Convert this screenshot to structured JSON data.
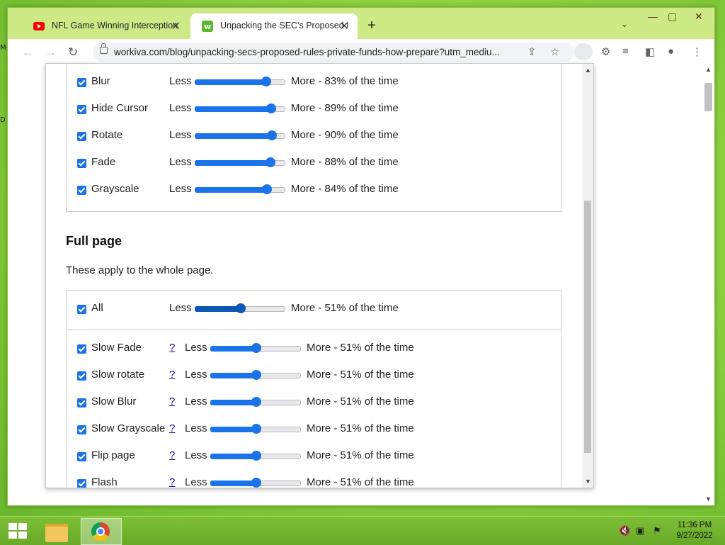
{
  "browser": {
    "tabs": [
      {
        "title": "NFL Game Winning Interception",
        "favicon": "youtube-icon",
        "active": false
      },
      {
        "title": "Unpacking the SEC's Proposed R",
        "favicon": "workiva-icon",
        "active": true
      }
    ],
    "url": "workiva.com/blog/unpacking-secs-proposed-rules-private-funds-how-prepare?utm_mediu..."
  },
  "popup": {
    "top_items": [
      {
        "label": "Blur",
        "less": "Less",
        "value": 83,
        "more": "More - 83% of the time"
      },
      {
        "label": "Hide Cursor",
        "less": "Less",
        "value": 89,
        "more": "More - 89% of the time"
      },
      {
        "label": "Rotate",
        "less": "Less",
        "value": 90,
        "more": "More - 90% of the time"
      },
      {
        "label": "Fade",
        "less": "Less",
        "value": 88,
        "more": "More - 88% of the time"
      },
      {
        "label": "Grayscale",
        "less": "Less",
        "value": 84,
        "more": "More - 84% of the time"
      }
    ],
    "full_page": {
      "heading": "Full page",
      "description": "These apply to the whole page.",
      "all": {
        "label": "All",
        "less": "Less",
        "value": 51,
        "more": "More - 51% of the time"
      },
      "items": [
        {
          "label": "Slow Fade",
          "help": "?",
          "less": "Less",
          "value": 51,
          "more": "More - 51% of the time"
        },
        {
          "label": "Slow rotate",
          "help": "?",
          "less": "Less",
          "value": 51,
          "more": "More - 51% of the time"
        },
        {
          "label": "Slow Blur",
          "help": "?",
          "less": "Less",
          "value": 51,
          "more": "More - 51% of the time"
        },
        {
          "label": "Slow Grayscale",
          "help": "?",
          "less": "Less",
          "value": 51,
          "more": "More - 51% of the time"
        },
        {
          "label": "Flip page",
          "help": "?",
          "less": "Less",
          "value": 51,
          "more": "More - 51% of the time"
        },
        {
          "label": "Flash",
          "help": "?",
          "less": "Less",
          "value": 51,
          "more": "More - 51% of the time"
        }
      ]
    }
  },
  "taskbar": {
    "time": "11:36 PM",
    "date": "9/27/2022"
  },
  "colors": {
    "accent": "#1a73e8",
    "desktop": "#8fd13e"
  }
}
